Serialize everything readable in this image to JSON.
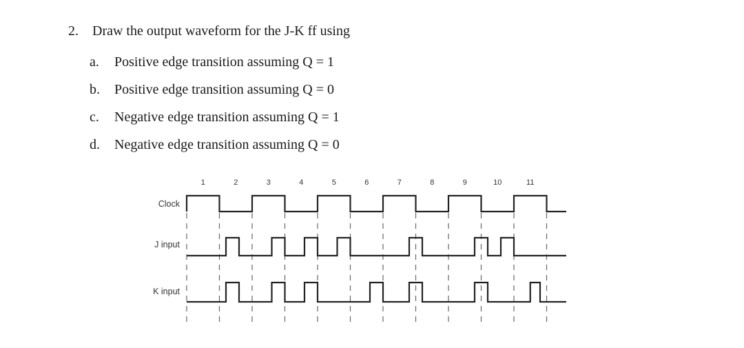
{
  "question": {
    "number": "2.",
    "prompt": "Draw the output waveform for the J-K ff using",
    "items": [
      {
        "letter": "a.",
        "text": "Positive edge transition  assuming Q = 1"
      },
      {
        "letter": "b.",
        "text": "Positive edge transition  assuming Q = 0"
      },
      {
        "letter": "c.",
        "text": "Negative edge transition  assuming Q = 1"
      },
      {
        "letter": "d.",
        "text": "Negative edge  transition  assuming Q = 0"
      }
    ]
  },
  "chart_data": {
    "type": "timing-diagram",
    "title": "",
    "time_unit": "clock half-period",
    "time_range": [
      0,
      11.6
    ],
    "tick_labels": [
      "1",
      "2",
      "3",
      "4",
      "5",
      "6",
      "7",
      "8",
      "9",
      "10",
      "11"
    ],
    "guide_lines_at": [
      0,
      1,
      2,
      3,
      4,
      5,
      6,
      7,
      8,
      9,
      10,
      11
    ],
    "signals": [
      {
        "name": "Clock",
        "initial": 1,
        "transitions": [
          0,
          1,
          2,
          3,
          4,
          5,
          6,
          7,
          8,
          9,
          10,
          11
        ],
        "end": 11.6,
        "pulses": [
          [
            0,
            1
          ],
          [
            2,
            3
          ],
          [
            4,
            5
          ],
          [
            6,
            7
          ],
          [
            8,
            9
          ],
          [
            10,
            11
          ]
        ]
      },
      {
        "name": "J input",
        "initial": 0,
        "end": 11.6,
        "pulses": [
          [
            1.2,
            1.6
          ],
          [
            2.6,
            3.0
          ],
          [
            3.6,
            4.0
          ],
          [
            4.6,
            5.0
          ],
          [
            6.8,
            7.2
          ],
          [
            8.8,
            9.2
          ],
          [
            9.6,
            10.0
          ]
        ]
      },
      {
        "name": "K input",
        "initial": 0,
        "end": 11.6,
        "pulses": [
          [
            1.2,
            1.6
          ],
          [
            2.6,
            3.0
          ],
          [
            3.6,
            4.0
          ],
          [
            5.6,
            6.0
          ],
          [
            6.8,
            7.2
          ],
          [
            8.8,
            9.2
          ],
          [
            10.5,
            10.8
          ]
        ]
      }
    ]
  }
}
